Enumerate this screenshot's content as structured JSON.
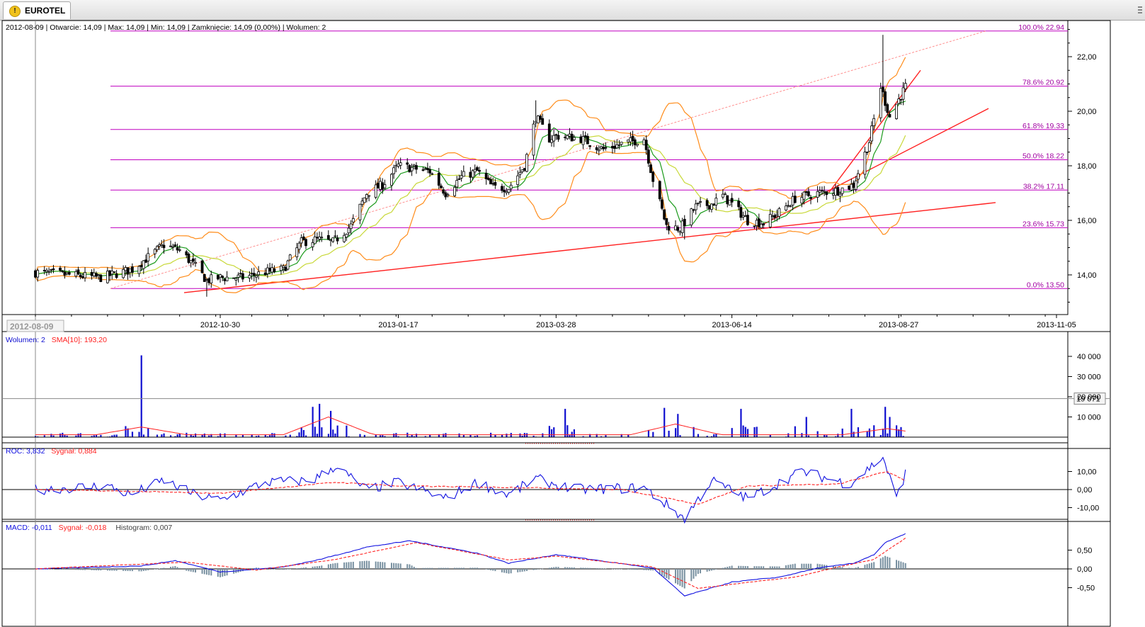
{
  "tab": {
    "title": "EUROTEL",
    "icon": "warning-icon"
  },
  "header": {
    "info": "2012-08-09 | Otwarcie: 14,09 | Max: 14,09 | Min: 14,09 | Zamknięcie: 14,09 (0,00%)  | Wolumen: 2",
    "cursor_date": "2012-08-09"
  },
  "colors": {
    "candle": "#000000",
    "bollinger": "#ff8c1a",
    "ma_fast": "#1a9a1a",
    "ma_slow": "#c8d838",
    "fib": "#c000c0",
    "trend": "#ff2020",
    "volume": "#1010d0",
    "sma": "#ff2020",
    "roc": "#1010e0",
    "signal": "#ff2020",
    "histogram": "#7890a0"
  },
  "chart_data": [
    {
      "type": "candlestick",
      "title": "EUROTEL",
      "x_tick_labels": [
        "2012-10-30",
        "2013-01-17",
        "2013-03-28",
        "2013-06-14",
        "2013-08-27",
        "2013-11-05"
      ],
      "y_tick_labels": [
        "14,00",
        "16,00",
        "18,00",
        "20,00",
        "22,00"
      ],
      "ylim": [
        12.8,
        23.4
      ],
      "first_date": "2012-08-09",
      "last_date": "2013-08-30",
      "fibonacci": [
        {
          "label": "100.0% 22.94",
          "value": 22.94
        },
        {
          "label": "78.6% 20.92",
          "value": 20.92
        },
        {
          "label": "61.8% 19.33",
          "value": 19.33
        },
        {
          "label": "50.0% 18.22",
          "value": 18.22
        },
        {
          "label": "38.2% 17.11",
          "value": 17.11
        },
        {
          "label": "23.6% 15.73",
          "value": 15.73
        },
        {
          "label": "0.0% 13.50",
          "value": 13.5
        }
      ],
      "close_path": [
        [
          "2012-08-09",
          14.09
        ],
        [
          "2012-08-24",
          14.0
        ],
        [
          "2012-09-07",
          13.9
        ],
        [
          "2012-09-21",
          14.2
        ],
        [
          "2012-10-05",
          15.1
        ],
        [
          "2012-10-12",
          14.9
        ],
        [
          "2012-10-19",
          14.3
        ],
        [
          "2012-10-24",
          13.8
        ],
        [
          "2012-10-30",
          13.9
        ],
        [
          "2012-11-09",
          13.9
        ],
        [
          "2012-11-19",
          14.1
        ],
        [
          "2012-11-27",
          14.2
        ],
        [
          "2012-12-05",
          15.2
        ],
        [
          "2012-12-12",
          15.3
        ],
        [
          "2012-12-19",
          15.2
        ],
        [
          "2012-12-27",
          15.8
        ],
        [
          "2013-01-03",
          17.0
        ],
        [
          "2013-01-10",
          17.3
        ],
        [
          "2013-01-17",
          18.0
        ],
        [
          "2013-01-24",
          17.9
        ],
        [
          "2013-01-31",
          17.8
        ],
        [
          "2013-02-07",
          17.0
        ],
        [
          "2013-02-14",
          17.6
        ],
        [
          "2013-02-21",
          17.8
        ],
        [
          "2013-02-28",
          17.2
        ],
        [
          "2013-03-07",
          17.2
        ],
        [
          "2013-03-14",
          18.0
        ],
        [
          "2013-03-19",
          19.8
        ],
        [
          "2013-03-25",
          19.0
        ],
        [
          "2013-03-28",
          19.1
        ],
        [
          "2013-04-08",
          19.0
        ],
        [
          "2013-04-18",
          18.6
        ],
        [
          "2013-04-26",
          18.8
        ],
        [
          "2013-05-06",
          19.0
        ],
        [
          "2013-05-10",
          17.5
        ],
        [
          "2013-05-16",
          15.8
        ],
        [
          "2013-05-22",
          15.7
        ],
        [
          "2013-05-29",
          16.5
        ],
        [
          "2013-06-05",
          16.6
        ],
        [
          "2013-06-10",
          16.9
        ],
        [
          "2013-06-14",
          16.6
        ],
        [
          "2013-06-21",
          16.0
        ],
        [
          "2013-06-28",
          15.9
        ],
        [
          "2013-07-05",
          16.3
        ],
        [
          "2013-07-12",
          16.8
        ],
        [
          "2013-07-22",
          17.0
        ],
        [
          "2013-07-31",
          17.1
        ],
        [
          "2013-08-07",
          17.3
        ],
        [
          "2013-08-14",
          18.9
        ],
        [
          "2013-08-19",
          20.9
        ],
        [
          "2013-08-23",
          19.8
        ],
        [
          "2013-08-30",
          20.9
        ]
      ],
      "notable_highs": [
        [
          "2013-03-19",
          20.4
        ],
        [
          "2013-08-20",
          22.8
        ]
      ],
      "notable_lows": [
        [
          "2012-10-24",
          13.2
        ],
        [
          "2013-05-24",
          15.3
        ]
      ]
    },
    {
      "type": "bar",
      "title": "Wolumen",
      "legend": [
        {
          "label": "Wolumen: 2",
          "color": "#1010d0"
        },
        {
          "label": "SMA[10]: 193,20",
          "color": "#ff2020"
        }
      ],
      "y_tick_labels": [
        "10 000",
        "20 000",
        "30 000",
        "40 000"
      ],
      "ylim": [
        0,
        42000
      ],
      "marker_label": "19 071",
      "marker_value": 19071,
      "spikes": [
        [
          "2012-09-25",
          40500
        ],
        [
          "2012-12-10",
          15000
        ],
        [
          "2012-12-13",
          16500
        ],
        [
          "2012-12-18",
          13000
        ],
        [
          "2013-04-01",
          14000
        ],
        [
          "2013-05-15",
          14500
        ],
        [
          "2013-05-21",
          11500
        ],
        [
          "2013-06-18",
          14000
        ],
        [
          "2013-07-17",
          10000
        ],
        [
          "2013-08-06",
          14000
        ],
        [
          "2013-08-21",
          15000
        ],
        [
          "2013-08-23",
          10000
        ]
      ],
      "sma_baseline": 1200,
      "sma_peaks": [
        [
          "2012-09-25",
          5000
        ],
        [
          "2012-12-17",
          10000
        ],
        [
          "2013-05-20",
          6500
        ],
        [
          "2013-08-22",
          4200
        ]
      ]
    },
    {
      "type": "line",
      "title": "ROC",
      "legend": [
        {
          "label": "ROC: 3,832",
          "color": "#1010e0"
        },
        {
          "label": "Sygnał: 0,884",
          "color": "#ff2020"
        }
      ],
      "y_tick_labels": [
        "-10,00",
        "0,00",
        "10,00"
      ],
      "ylim": [
        -16,
        18
      ],
      "roc": [
        [
          "2012-08-09",
          0
        ],
        [
          "2012-09-10",
          2
        ],
        [
          "2012-09-20",
          -3
        ],
        [
          "2012-10-05",
          5
        ],
        [
          "2012-10-19",
          -3
        ],
        [
          "2012-10-30",
          -6
        ],
        [
          "2012-11-19",
          4
        ],
        [
          "2012-12-10",
          5
        ],
        [
          "2012-12-20",
          13
        ],
        [
          "2013-01-03",
          0
        ],
        [
          "2013-01-17",
          4
        ],
        [
          "2013-02-07",
          -5
        ],
        [
          "2013-02-21",
          4
        ],
        [
          "2013-03-07",
          -3
        ],
        [
          "2013-03-19",
          6
        ],
        [
          "2013-04-05",
          0
        ],
        [
          "2013-05-06",
          1
        ],
        [
          "2013-05-24",
          -16
        ],
        [
          "2013-06-05",
          5
        ],
        [
          "2013-06-21",
          -5
        ],
        [
          "2013-07-15",
          10
        ],
        [
          "2013-08-05",
          3
        ],
        [
          "2013-08-20",
          18
        ],
        [
          "2013-08-26",
          -5
        ],
        [
          "2013-08-30",
          9
        ]
      ],
      "signal": [
        [
          "2012-08-09",
          0
        ],
        [
          "2012-10-30",
          -2
        ],
        [
          "2012-12-20",
          4
        ],
        [
          "2013-01-17",
          2
        ],
        [
          "2013-03-19",
          1
        ],
        [
          "2013-04-26",
          0
        ],
        [
          "2013-05-30",
          -8
        ],
        [
          "2013-06-21",
          2
        ],
        [
          "2013-07-31",
          3
        ],
        [
          "2013-08-22",
          10
        ],
        [
          "2013-08-30",
          5
        ]
      ]
    },
    {
      "type": "line",
      "title": "MACD",
      "legend": [
        {
          "label": "MACD: -0,011",
          "color": "#1010e0"
        },
        {
          "label": "Sygnał: -0,018",
          "color": "#ff2020"
        },
        {
          "label": "Histogram: 0,007",
          "color": "#404040"
        }
      ],
      "y_tick_labels": [
        "-0,50",
        "0,00",
        "0,50"
      ],
      "ylim": [
        -0.85,
        1.05
      ],
      "macd": [
        [
          "2012-08-09",
          0.0
        ],
        [
          "2012-09-25",
          0.08
        ],
        [
          "2012-10-10",
          0.22
        ],
        [
          "2012-10-30",
          -0.08
        ],
        [
          "2012-11-27",
          0.05
        ],
        [
          "2012-12-13",
          0.25
        ],
        [
          "2013-01-03",
          0.58
        ],
        [
          "2013-01-22",
          0.75
        ],
        [
          "2013-02-21",
          0.42
        ],
        [
          "2013-03-07",
          0.15
        ],
        [
          "2013-03-28",
          0.38
        ],
        [
          "2013-04-26",
          0.14
        ],
        [
          "2013-05-10",
          0.02
        ],
        [
          "2013-05-24",
          -0.72
        ],
        [
          "2013-06-14",
          -0.35
        ],
        [
          "2013-07-05",
          -0.22
        ],
        [
          "2013-07-22",
          0.02
        ],
        [
          "2013-08-07",
          0.15
        ],
        [
          "2013-08-16",
          0.38
        ],
        [
          "2013-08-21",
          0.7
        ],
        [
          "2013-08-30",
          0.93
        ]
      ],
      "signal": [
        [
          "2012-08-09",
          0.0
        ],
        [
          "2012-10-15",
          0.18
        ],
        [
          "2012-11-15",
          -0.03
        ],
        [
          "2012-12-20",
          0.25
        ],
        [
          "2013-01-25",
          0.7
        ],
        [
          "2013-03-07",
          0.24
        ],
        [
          "2013-03-28",
          0.34
        ],
        [
          "2013-05-10",
          0.05
        ],
        [
          "2013-05-30",
          -0.52
        ],
        [
          "2013-06-21",
          -0.36
        ],
        [
          "2013-07-12",
          -0.22
        ],
        [
          "2013-07-31",
          0.05
        ],
        [
          "2013-08-16",
          0.25
        ],
        [
          "2013-08-30",
          0.82
        ]
      ]
    }
  ]
}
